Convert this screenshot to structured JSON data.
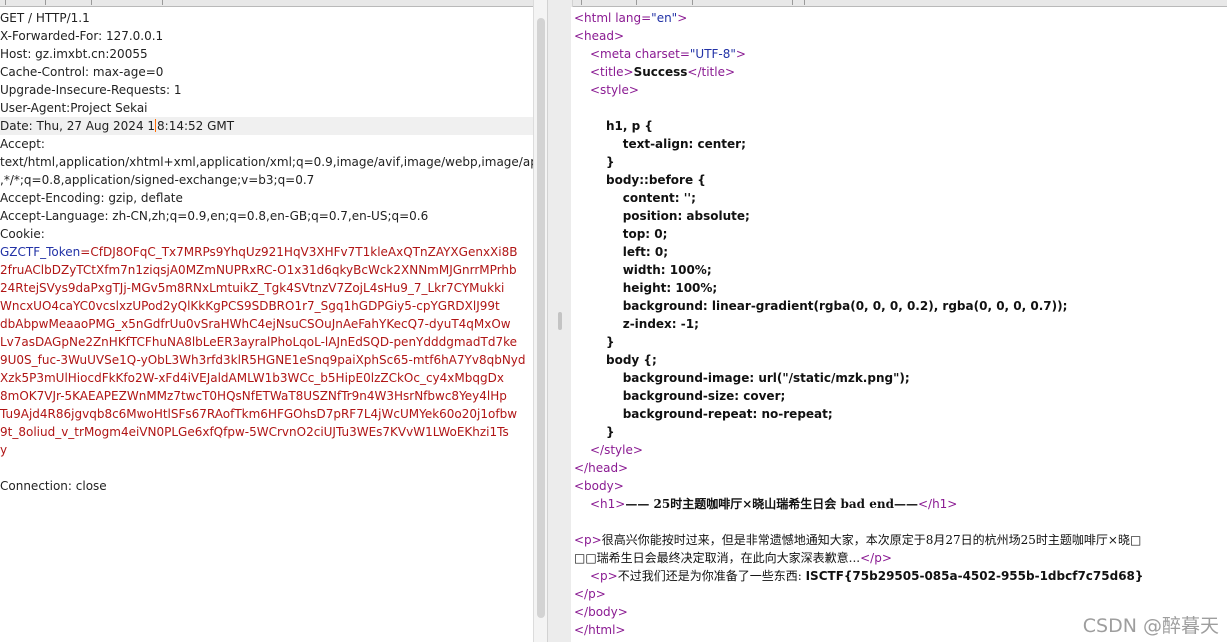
{
  "request": {
    "request_line": "GET / HTTP/1.1",
    "headers": [
      "X-Forwarded-For: 127.0.0.1",
      "Host: gz.imxbt.cn:20055",
      "Cache-Control: max-age=0",
      "Upgrade-Insecure-Requests: 1",
      "User-Agent:Project Sekai"
    ],
    "date_before_caret": "Date: Thu, 27 Aug 2024 1",
    "date_after_caret": "8:14:52 GMT",
    "accept_label": "Accept:",
    "accept_lines": [
      "text/html,application/xhtml+xml,application/xml;q=0.9,image/avif,image/webp,image/apng",
      ",*/*;q=0.8,application/signed-exchange;v=b3;q=0.7"
    ],
    "accept_encoding": "Accept-Encoding: gzip, deflate",
    "accept_language": "Accept-Language: zh-CN,zh;q=0.9,en;q=0.8,en-GB;q=0.7,en-US;q=0.6",
    "cookie_label": "Cookie:",
    "token_name": "GZCTF_Token",
    "token_eq": "=",
    "token_first": "CfDJ8OFqC_Tx7MRPs9YhqUz921HqV3XHFv7T1kleAxQTnZAYXGenxXi8B",
    "token_lines": [
      "2fruAClbDZyTCtXfm7n1ziqsjA0MZmNUPRxRC-O1x31d6qkyBcWck2XNNmMJGnrrMPrhb",
      "24RtejSVys9daPxgTJj-MGv5m8RNxLmtuikZ_Tgk4SVtnzV7ZojL4sHu9_7_Lkr7CYMukki",
      "WncxUO4caYC0vcslxzUPod2yQlKkKgPCS9SDBRO1r7_Sgq1hGDPGiy5-cpYGRDXlJ99t",
      "dbAbpwMeaaoPMG_x5nGdfrUu0vSraHWhC4ejNsuCSOuJnAeFahYKecQ7-dyuT4qMxOw",
      "Lv7asDAGpNe2ZnHKfTCFhuNA8lbLeER3ayralPhoLqoL-lAJnEdSQD-penYdddgmadTd7ke",
      "9U0S_fuc-3WuUVSe1Q-yObL3Wh3rfd3klR5HGNE1eSnq9paiXphSc65-mtf6hA7Yv8qbNyd",
      "Xzk5P3mUlHiocdFkKfo2W-xFd4iVEJaldAMLW1b3WCc_b5HipE0lzZCkOc_cy4xMbqgDx",
      "8mOK7VJr-5KAEAPEZWnMMz7twcT0HQsNfETWaT8USZNfTr9n4W3HsrNfbwc8Yey4lHp",
      "Tu9Ajd4R86jgvqb8c6MwoHtlSFs67RAofTkm6HFGOhsD7pRF7L4jWcUMYek60o20j1ofbw",
      "9t_8oliud_v_trMogm4eiVN0PLGe6xfQfpw-5WCrvnO2ciUJTu3WEs7KVvW1LWoEKhzi1Ts",
      "y"
    ],
    "connection": "Connection: close"
  },
  "response": {
    "html_open": "<html",
    "html_attr": " lang=",
    "html_attr_val": "\"en\"",
    "html_close": ">",
    "head_open": "<head>",
    "meta_open": "<meta",
    "meta_attr": " charset=",
    "meta_attr_val": "\"UTF-8\"",
    "meta_close": ">",
    "title_open": "<title>",
    "title_text": "Success",
    "title_close": "</title>",
    "style_open": "<style>",
    "css_lines": [
      "h1, p {",
      "    text-align: center;",
      "}",
      "body::before {",
      "    content: '';",
      "    position: absolute;",
      "    top: 0;",
      "    left: 0;",
      "    width: 100%;",
      "    height: 100%;",
      "    background: linear-gradient(rgba(0, 0, 0, 0.2), rgba(0, 0, 0, 0.7));",
      "    z-index: -1;",
      "}",
      "body {;",
      "    background-image: url(\"/static/mzk.png\");",
      "    background-size: cover;",
      "    background-repeat: no-repeat;",
      "}"
    ],
    "style_close": "</style>",
    "head_close": "</head>",
    "body_open": "<body>",
    "h1_open": "<h1>",
    "h1_text": "—— 25时主题咖啡厅×晓山瑞希生日会 bad end——",
    "h1_close": "</h1>",
    "p1_open": "<p>",
    "p1_text_a": "很高兴你能按时过来，但是非常遗憾地通知大家，本次原定于8月27日的杭州场25时主题咖啡厅×晓□",
    "p1_text_b": "□□瑞希生日会最终决定取消，在此向大家深表歉意...",
    "p1_close": "</p>",
    "p2_open": "<p>",
    "p2_text_a": "不过我们还是为你准备了一些东西: ",
    "p2_flag": "ISCTF{75b29505-085a-4502-955b-1dbcf7c75d68}",
    "p_close": "</p>",
    "body_close": "</body>",
    "html_end": "</html>"
  },
  "watermark": "CSDN @醉暮天",
  "colors": {
    "tag": "#8a1a92",
    "attr_value": "#2232a6",
    "cookie_value": "#b01515",
    "caret": "#ff6a00"
  }
}
